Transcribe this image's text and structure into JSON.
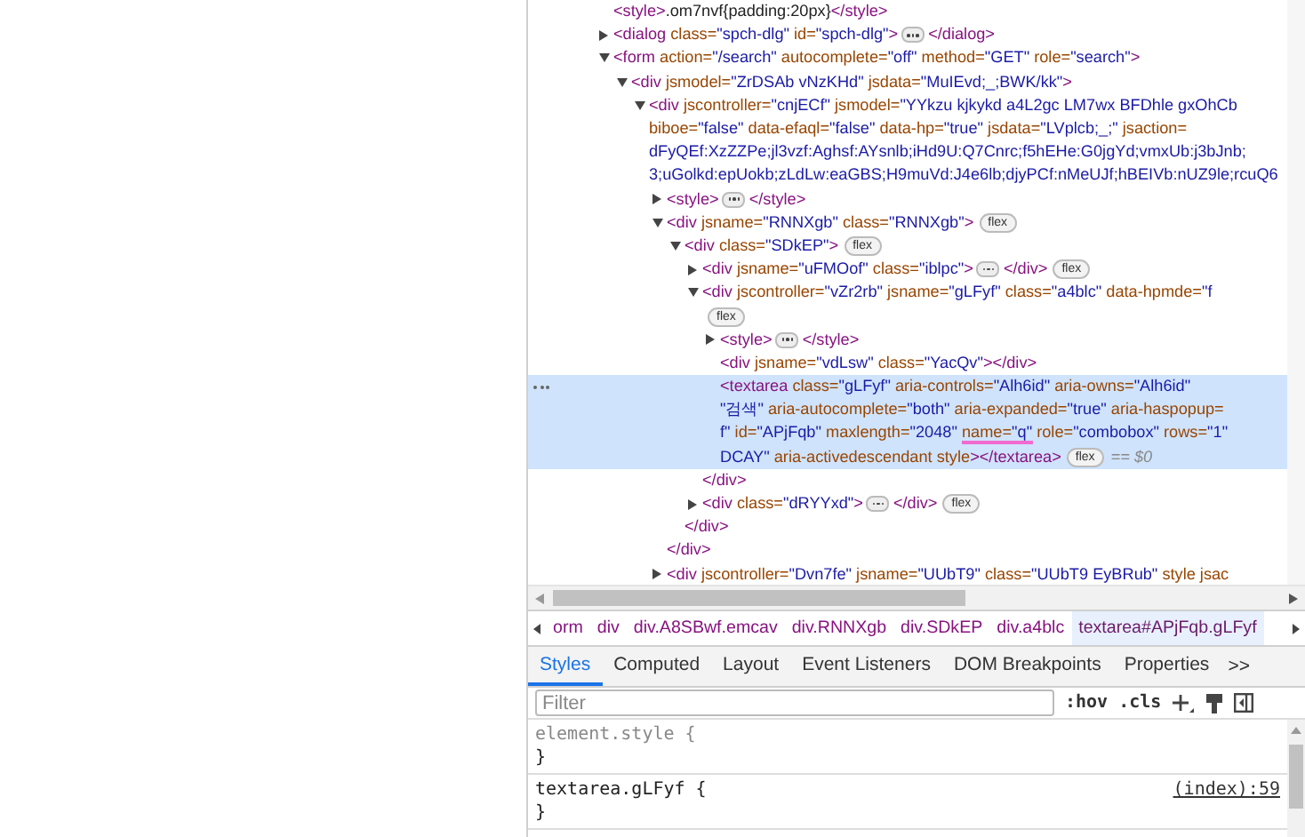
{
  "elements_tree": [
    {
      "selected": false,
      "lines": [
        [
          {
            "kind": "tag",
            "text": "<style>"
          },
          {
            "kind": "text",
            "text": ".om7nvf{padding:20px}"
          },
          {
            "kind": "tag",
            "text": "</style>"
          }
        ]
      ]
    },
    {
      "selected": false,
      "expanded": false,
      "lines": [
        [
          {
            "kind": "tag",
            "text": "<dialog"
          },
          {
            "kind": "attr",
            "text": " class="
          },
          {
            "kind": "value",
            "text": "\"spch-dlg\""
          },
          {
            "kind": "attr",
            "text": " id="
          },
          {
            "kind": "value",
            "text": "\"spch-dlg\""
          },
          {
            "kind": "tag",
            "text": ">"
          }
        ]
      ],
      "close": [
        {
          "kind": "tag",
          "text": "</dialog>"
        }
      ]
    },
    {
      "selected": false,
      "expanded": true,
      "lines": [
        [
          {
            "kind": "tag",
            "text": "<form"
          },
          {
            "kind": "attr",
            "text": " action="
          },
          {
            "kind": "value",
            "text": "\"/search\""
          },
          {
            "kind": "attr",
            "text": " autocomplete="
          },
          {
            "kind": "value",
            "text": "\"off\""
          },
          {
            "kind": "attr",
            "text": " method="
          },
          {
            "kind": "value",
            "text": "\"GET\""
          },
          {
            "kind": "attr",
            "text": " role="
          },
          {
            "kind": "value",
            "text": "\"search\""
          },
          {
            "kind": "tag",
            "text": ">"
          }
        ]
      ],
      "children": [
        {
          "selected": false,
          "expanded": true,
          "lines": [
            [
              {
                "kind": "tag",
                "text": "<div"
              },
              {
                "kind": "attr",
                "text": " jsmodel="
              },
              {
                "kind": "value",
                "text": "\"ZrDSAb vNzKHd\""
              },
              {
                "kind": "attr",
                "text": " jsdata="
              },
              {
                "kind": "value",
                "text": "\"MuIEvd;_;BWK/kk\""
              },
              {
                "kind": "tag",
                "text": ">"
              }
            ]
          ],
          "children": [
            {
              "selected": false,
              "expanded": true,
              "lines": [
                [
                  {
                    "kind": "tag",
                    "text": "<div"
                  },
                  {
                    "kind": "attr",
                    "text": " jscontroller="
                  },
                  {
                    "kind": "value",
                    "text": "\"cnjECf\""
                  },
                  {
                    "kind": "attr",
                    "text": " jsmodel="
                  },
                  {
                    "kind": "value",
                    "text": "\"YYkzu kjkykd a4L2gc LM7wx BFDhle gxOhCb"
                  }
                ],
                [
                  {
                    "kind": "attr",
                    "text": "biboe="
                  },
                  {
                    "kind": "value",
                    "text": "\"false\""
                  },
                  {
                    "kind": "attr",
                    "text": " data-efaql="
                  },
                  {
                    "kind": "value",
                    "text": "\"false\""
                  },
                  {
                    "kind": "attr",
                    "text": " data-hp="
                  },
                  {
                    "kind": "value",
                    "text": "\"true\""
                  },
                  {
                    "kind": "attr",
                    "text": " jsdata="
                  },
                  {
                    "kind": "value",
                    "text": "\"LVplcb;_;\""
                  },
                  {
                    "kind": "attr",
                    "text": " jsaction="
                  }
                ],
                [
                  {
                    "kind": "value",
                    "text": "dFyQEf:XzZZPe;jl3vzf:Aghsf:AYsnlb;iHd9U:Q7Cnrc;f5hEHe:G0jgYd;vmxUb:j3bJnb;"
                  }
                ],
                [
                  {
                    "kind": "value",
                    "text": "3;uGolkd:epUokb;zLdLw:eaGBS;H9muVd:J4e6lb;djyPCf:nMeUJf;hBEIVb:nUZ9le;rcuQ6"
                  }
                ]
              ],
              "children": [
                {
                  "selected": false,
                  "expanded": false,
                  "lines": [
                    [
                      {
                        "kind": "tag",
                        "text": "<style>"
                      }
                    ]
                  ],
                  "close": [
                    {
                      "kind": "tag",
                      "text": "</style>"
                    }
                  ]
                },
                {
                  "selected": false,
                  "expanded": true,
                  "badge": "flex",
                  "lines": [
                    [
                      {
                        "kind": "tag",
                        "text": "<div"
                      },
                      {
                        "kind": "attr",
                        "text": " jsname="
                      },
                      {
                        "kind": "value",
                        "text": "\"RNNXgb\""
                      },
                      {
                        "kind": "attr",
                        "text": " class="
                      },
                      {
                        "kind": "value",
                        "text": "\"RNNXgb\""
                      },
                      {
                        "kind": "tag",
                        "text": ">"
                      }
                    ]
                  ],
                  "children": [
                    {
                      "selected": false,
                      "expanded": true,
                      "badge": "flex",
                      "lines": [
                        [
                          {
                            "kind": "tag",
                            "text": "<div"
                          },
                          {
                            "kind": "attr",
                            "text": " class="
                          },
                          {
                            "kind": "value",
                            "text": "\"SDkEP\""
                          },
                          {
                            "kind": "tag",
                            "text": ">"
                          }
                        ]
                      ],
                      "children": [
                        {
                          "selected": false,
                          "expanded": false,
                          "badge": "flex",
                          "lines": [
                            [
                              {
                                "kind": "tag",
                                "text": "<div"
                              },
                              {
                                "kind": "attr",
                                "text": " jsname="
                              },
                              {
                                "kind": "value",
                                "text": "\"uFMOof\""
                              },
                              {
                                "kind": "attr",
                                "text": " class="
                              },
                              {
                                "kind": "value",
                                "text": "\"iblpc\""
                              },
                              {
                                "kind": "tag",
                                "text": ">"
                              }
                            ]
                          ],
                          "close": [
                            {
                              "kind": "tag",
                              "text": "</div>"
                            }
                          ]
                        },
                        {
                          "selected": false,
                          "expanded": true,
                          "badge": "flex",
                          "badge_on_own_line": true,
                          "lines": [
                            [
                              {
                                "kind": "tag",
                                "text": "<div"
                              },
                              {
                                "kind": "attr",
                                "text": " jscontroller="
                              },
                              {
                                "kind": "value",
                                "text": "\"vZr2rb\""
                              },
                              {
                                "kind": "attr",
                                "text": " jsname="
                              },
                              {
                                "kind": "value",
                                "text": "\"gLFyf\""
                              },
                              {
                                "kind": "attr",
                                "text": " class="
                              },
                              {
                                "kind": "value",
                                "text": "\"a4blc\""
                              },
                              {
                                "kind": "attr",
                                "text": " data-hpmde="
                              },
                              {
                                "kind": "value",
                                "text": "\"f"
                              }
                            ]
                          ],
                          "children": [
                            {
                              "selected": false,
                              "expanded": false,
                              "lines": [
                                [
                                  {
                                    "kind": "tag",
                                    "text": "<style>"
                                  }
                                ]
                              ],
                              "close": [
                                {
                                  "kind": "tag",
                                  "text": "</style>"
                                }
                              ]
                            },
                            {
                              "selected": false,
                              "lines": [
                                [
                                  {
                                    "kind": "tag",
                                    "text": "<div"
                                  },
                                  {
                                    "kind": "attr",
                                    "text": " jsname="
                                  },
                                  {
                                    "kind": "value",
                                    "text": "\"vdLsw\""
                                  },
                                  {
                                    "kind": "attr",
                                    "text": " class="
                                  },
                                  {
                                    "kind": "value",
                                    "text": "\"YacQv\""
                                  },
                                  {
                                    "kind": "tag",
                                    "text": "></div>"
                                  }
                                ]
                              ]
                            },
                            {
                              "selected": true,
                              "badge": "flex",
                              "console_ref": "== $0",
                              "lines": [
                                [
                                  {
                                    "kind": "tag",
                                    "text": "<textarea"
                                  },
                                  {
                                    "kind": "attr",
                                    "text": " class="
                                  },
                                  {
                                    "kind": "value",
                                    "text": "\"gLFyf\""
                                  },
                                  {
                                    "kind": "attr",
                                    "text": " aria-controls="
                                  },
                                  {
                                    "kind": "value",
                                    "text": "\"Alh6id\""
                                  },
                                  {
                                    "kind": "attr",
                                    "text": " aria-owns="
                                  },
                                  {
                                    "kind": "value",
                                    "text": "\"Alh6id\""
                                  }
                                ],
                                [
                                  {
                                    "kind": "value",
                                    "text": "\"검색\""
                                  },
                                  {
                                    "kind": "attr",
                                    "text": " aria-autocomplete="
                                  },
                                  {
                                    "kind": "value",
                                    "text": "\"both\""
                                  },
                                  {
                                    "kind": "attr",
                                    "text": " aria-expanded="
                                  },
                                  {
                                    "kind": "value",
                                    "text": "\"true\""
                                  },
                                  {
                                    "kind": "attr",
                                    "text": " aria-haspopup="
                                  }
                                ],
                                [
                                  {
                                    "kind": "value",
                                    "text": "f\""
                                  },
                                  {
                                    "kind": "attr",
                                    "text": " id="
                                  },
                                  {
                                    "kind": "value",
                                    "text": "\"APjFqb\""
                                  },
                                  {
                                    "kind": "attr",
                                    "text": " maxlength="
                                  },
                                  {
                                    "kind": "value",
                                    "text": "\"2048\" "
                                  },
                                  {
                                    "kind": "underlined_attr",
                                    "text": "name="
                                  },
                                  {
                                    "kind": "underlined_value",
                                    "text": "\"q\""
                                  },
                                  {
                                    "kind": "attr",
                                    "text": " role="
                                  },
                                  {
                                    "kind": "value",
                                    "text": "\"combobox\""
                                  },
                                  {
                                    "kind": "attr",
                                    "text": " rows="
                                  },
                                  {
                                    "kind": "value",
                                    "text": "\"1\""
                                  }
                                ],
                                [
                                  {
                                    "kind": "value",
                                    "text": "DCAY\""
                                  },
                                  {
                                    "kind": "attr",
                                    "text": " aria-activedescendant style"
                                  },
                                  {
                                    "kind": "tag",
                                    "text": "></textarea>"
                                  }
                                ]
                              ]
                            }
                          ],
                          "close": [
                            {
                              "kind": "tag",
                              "text": "</div>"
                            }
                          ]
                        },
                        {
                          "selected": false,
                          "expanded": false,
                          "badge": "flex",
                          "lines": [
                            [
                              {
                                "kind": "tag",
                                "text": "<div"
                              },
                              {
                                "kind": "attr",
                                "text": " class="
                              },
                              {
                                "kind": "value",
                                "text": "\"dRYYxd\""
                              },
                              {
                                "kind": "tag",
                                "text": ">"
                              }
                            ]
                          ],
                          "close": [
                            {
                              "kind": "tag",
                              "text": "</div>"
                            }
                          ]
                        }
                      ],
                      "close": [
                        {
                          "kind": "tag",
                          "text": "</div>"
                        }
                      ]
                    }
                  ],
                  "close": [
                    {
                      "kind": "tag",
                      "text": "</div>"
                    }
                  ]
                },
                {
                  "selected": false,
                  "expanded": false,
                  "lines": [
                    [
                      {
                        "kind": "tag",
                        "text": "<div"
                      },
                      {
                        "kind": "attr",
                        "text": " jscontroller="
                      },
                      {
                        "kind": "value",
                        "text": "\"Dvn7fe\""
                      },
                      {
                        "kind": "attr",
                        "text": " jsname="
                      },
                      {
                        "kind": "value",
                        "text": "\"UUbT9\""
                      },
                      {
                        "kind": "attr",
                        "text": " class="
                      },
                      {
                        "kind": "value",
                        "text": "\"UUbT9 EyBRub\""
                      },
                      {
                        "kind": "attr",
                        "text": " style jsac"
                      }
                    ]
                  ]
                }
              ]
            }
          ]
        }
      ]
    }
  ],
  "breadcrumbs": [
    {
      "text": "orm",
      "selected": false
    },
    {
      "text": "div",
      "selected": false
    },
    {
      "text": "div.A8SBwf.emcav",
      "selected": false
    },
    {
      "text": "div.RNNXgb",
      "selected": false
    },
    {
      "text": "div.SDkEP",
      "selected": false
    },
    {
      "text": "div.a4blc",
      "selected": false
    },
    {
      "text": "textarea#APjFqb.gLFyf",
      "selected": true
    }
  ],
  "tabs": [
    {
      "label": "Styles",
      "selected": true
    },
    {
      "label": "Computed",
      "selected": false
    },
    {
      "label": "Layout",
      "selected": false
    },
    {
      "label": "Event Listeners",
      "selected": false
    },
    {
      "label": "DOM Breakpoints",
      "selected": false
    },
    {
      "label": "Properties",
      "selected": false
    }
  ],
  "tabs_overflow": ">>",
  "styles_toolbar": {
    "filter_placeholder": "Filter",
    "hov": ":hov",
    "cls": ".cls"
  },
  "style_rules": [
    {
      "kind": "inline",
      "selector": "element.style {",
      "close": "}"
    },
    {
      "kind": "stylesheet",
      "selector": "textarea.gLFyf {",
      "source": "(index):59",
      "close": "}"
    }
  ]
}
